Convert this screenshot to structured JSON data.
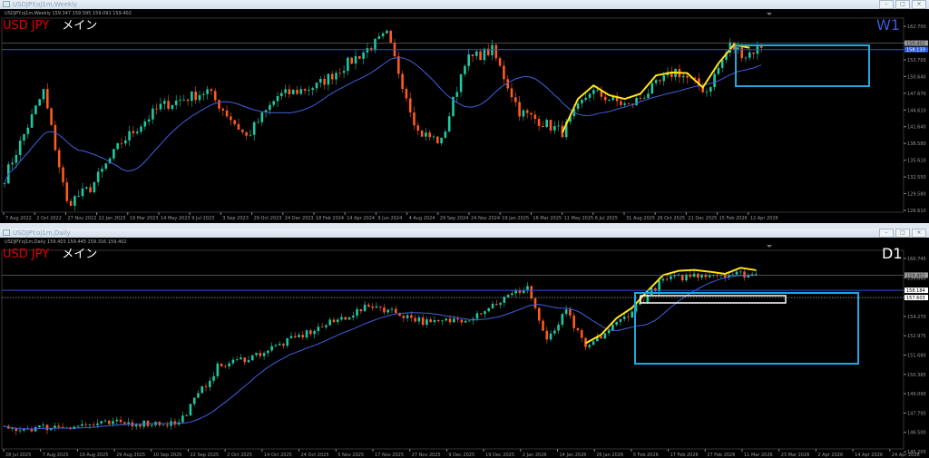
{
  "windows": [
    {
      "title": "USDJPY.oj1m,Weekly",
      "header": "USDJPY.oj1m,Weekly  159.347 159.595 159.091 159.402",
      "symbol": "USD JPY",
      "label": "メイン",
      "timeframe": "W1",
      "tf_color": "#3a5ad8",
      "price_labels": [
        "162.700",
        "156.670",
        "153.700",
        "150.640",
        "147.670",
        "144.610",
        "141.640",
        "138.580",
        "135.610",
        "132.550",
        "129.580",
        "126.610"
      ],
      "price_range": [
        126.61,
        162.7
      ],
      "current_price": "159.402",
      "ma_price": "158.133",
      "date_labels": [
        "7 Aug 2022",
        "2 Oct 2022",
        "27 Nov 2022",
        "22 Jan 2023",
        "19 Mar 2023",
        "14 May 2023",
        "9 Jul 2023",
        "3 Sep 2023",
        "29 Oct 2023",
        "24 Dec 2023",
        "18 Feb 2024",
        "14 Apr 2024",
        "9 Jun 2024",
        "4 Aug 2024",
        "29 Sep 2024",
        "24 Nov 2024",
        "19 Jan 2025",
        "16 Mar 2025",
        "11 May 2025",
        "6 Jul 2025",
        "31 Aug 2025",
        "26 Oct 2025",
        "21 Dec 2025",
        "15 Feb 2026",
        "12 Apr 2026"
      ]
    },
    {
      "title": "USDJPY.oj1m,Daily",
      "header": "USDJPY.oj1m,Daily  159.403 159.445 159.316 159.402",
      "symbol": "USD JPY",
      "label": "メイン",
      "timeframe": "D1",
      "tf_color": "#ffffff",
      "price_labels": [
        "160.745",
        "156.860",
        "155.565",
        "154.270",
        "152.975",
        "151.680",
        "150.385",
        "149.090",
        "147.795",
        "146.500",
        "145.205"
      ],
      "price_range": [
        145.205,
        160.745
      ],
      "current_price": "159.402",
      "ma_price": "158.184",
      "level_price": "157.603",
      "date_labels": [
        "28 Jul 2025",
        "7 Aug 2025",
        "19 Aug 2025",
        "29 Aug 2025",
        "10 Sep 2025",
        "22 Sep 2025",
        "2 Oct 2025",
        "14 Oct 2025",
        "24 Oct 2025",
        "5 Nov 2025",
        "17 Nov 2025",
        "27 Nov 2025",
        "9 Dec 2025",
        "19 Dec 2025",
        "2 Jan 2026",
        "14 Jan 2026",
        "26 Jan 2026",
        "5 Feb 2026",
        "17 Feb 2026",
        "27 Feb 2026",
        "11 Mar 2026",
        "23 Mar 2026",
        "2 Apr 2026",
        "14 Apr 2026",
        "24 Apr 2026"
      ]
    }
  ],
  "chart_data": [
    {
      "type": "candlestick",
      "timeframe": "W1",
      "bars": 195,
      "anchors": [
        [
          0,
          133
        ],
        [
          10,
          150
        ],
        [
          16,
          128
        ],
        [
          22,
          131
        ],
        [
          30,
          140
        ],
        [
          40,
          147
        ],
        [
          52,
          150
        ],
        [
          62,
          141
        ],
        [
          70,
          149
        ],
        [
          80,
          151
        ],
        [
          98,
          161
        ],
        [
          106,
          142
        ],
        [
          112,
          140
        ],
        [
          118,
          156
        ],
        [
          125,
          158
        ],
        [
          132,
          146
        ],
        [
          143,
          142
        ],
        [
          150,
          150
        ],
        [
          160,
          147
        ],
        [
          172,
          154
        ],
        [
          180,
          150
        ],
        [
          186,
          159
        ],
        [
          190,
          157
        ],
        [
          195,
          159.4
        ]
      ],
      "zigzag_from": 143
    },
    {
      "type": "candlestick",
      "timeframe": "D1",
      "bars": 195,
      "anchors": [
        [
          0,
          147
        ],
        [
          30,
          147.5
        ],
        [
          45,
          147.5
        ],
        [
          55,
          152
        ],
        [
          65,
          153
        ],
        [
          80,
          155
        ],
        [
          95,
          157
        ],
        [
          110,
          155.5
        ],
        [
          120,
          156
        ],
        [
          135,
          158.5
        ],
        [
          140,
          154
        ],
        [
          145,
          156.5
        ],
        [
          150,
          153.5
        ],
        [
          160,
          156
        ],
        [
          170,
          159
        ],
        [
          180,
          159.5
        ],
        [
          190,
          159.5
        ],
        [
          195,
          159.4
        ]
      ],
      "zigzag_from": 150
    }
  ]
}
